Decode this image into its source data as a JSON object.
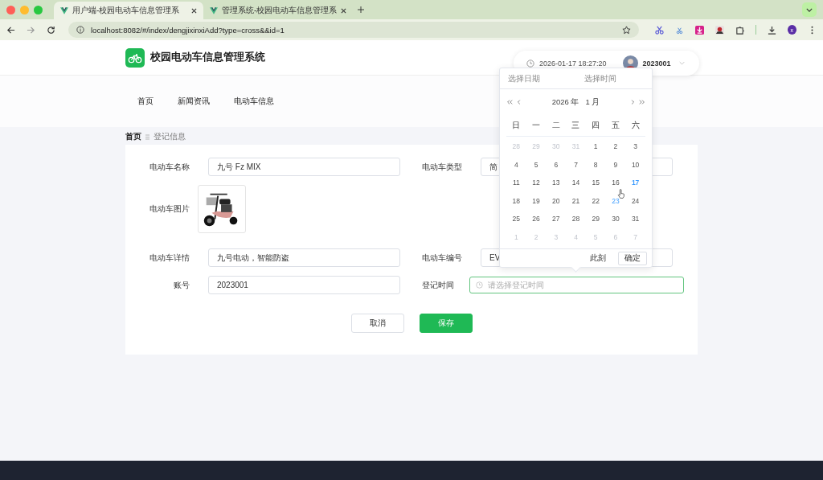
{
  "browser": {
    "tabs": [
      {
        "title": "用户端-校园电动车信息管理系",
        "selected": true
      },
      {
        "title": "管理系统-校园电动车信息管理系",
        "selected": false
      }
    ],
    "address": "localhost:8082/#/index/dengjixinxiAdd?type=cross&&id=1",
    "profile": "x"
  },
  "header": {
    "title": "校园电动车信息管理系统",
    "datetime": "2026-01-17 18:27:20",
    "user": "2023001"
  },
  "nav": [
    "首页",
    "新闻资讯",
    "电动车信息"
  ],
  "breadcrumb": [
    "首页",
    "登记信息"
  ],
  "form": {
    "rows": [
      [
        {
          "kind": "text",
          "label": "电动车名称",
          "value": "九号 Fz MIX"
        },
        {
          "kind": "text",
          "label": "电动车类型",
          "value": "简"
        }
      ],
      [
        {
          "label": "电动车图片"
        }
      ],
      [
        {
          "kind": "text",
          "label": "电动车详情",
          "value": "九号电动，智能防盗"
        },
        {
          "kind": "text",
          "label": "电动车编号",
          "value": "EV"
        }
      ],
      [
        {
          "kind": "text",
          "label": "账号",
          "value": "2023001"
        },
        {
          "kind": "datetime",
          "label": "登记时间",
          "placeholder": "请选择登记时间"
        }
      ]
    ],
    "buttons": [
      {
        "label": "取消",
        "kind": "default"
      },
      {
        "label": "保存",
        "kind": "primary"
      }
    ]
  },
  "calendar": {
    "tabs": [
      "选择日期",
      "选择时间"
    ],
    "year": "2026 年",
    "month": "1 月",
    "weekdays": [
      "日",
      "一",
      "二",
      "三",
      "四",
      "五",
      "六"
    ],
    "weeks": [
      [
        {
          "d": "28",
          "kind": "other"
        },
        {
          "d": "29",
          "kind": "other"
        },
        {
          "d": "30",
          "kind": "other"
        },
        {
          "d": "31",
          "kind": "other"
        },
        {
          "d": "1",
          "kind": "current"
        },
        {
          "d": "2",
          "kind": "current"
        },
        {
          "d": "3",
          "kind": "current"
        }
      ],
      [
        {
          "d": "4",
          "kind": "current"
        },
        {
          "d": "5",
          "kind": "current"
        },
        {
          "d": "6",
          "kind": "current"
        },
        {
          "d": "7",
          "kind": "current"
        },
        {
          "d": "8",
          "kind": "current"
        },
        {
          "d": "9",
          "kind": "current"
        },
        {
          "d": "10",
          "kind": "current"
        }
      ],
      [
        {
          "d": "11",
          "kind": "current"
        },
        {
          "d": "12",
          "kind": "current"
        },
        {
          "d": "13",
          "kind": "current"
        },
        {
          "d": "14",
          "kind": "current"
        },
        {
          "d": "15",
          "kind": "current"
        },
        {
          "d": "16",
          "kind": "current"
        },
        {
          "d": "17",
          "kind": "today"
        }
      ],
      [
        {
          "d": "18",
          "kind": "current"
        },
        {
          "d": "19",
          "kind": "current"
        },
        {
          "d": "20",
          "kind": "current"
        },
        {
          "d": "21",
          "kind": "current"
        },
        {
          "d": "22",
          "kind": "current"
        },
        {
          "d": "23",
          "kind": "hover"
        },
        {
          "d": "24",
          "kind": "current"
        }
      ],
      [
        {
          "d": "25",
          "kind": "current"
        },
        {
          "d": "26",
          "kind": "current"
        },
        {
          "d": "27",
          "kind": "current"
        },
        {
          "d": "28",
          "kind": "current"
        },
        {
          "d": "29",
          "kind": "current"
        },
        {
          "d": "30",
          "kind": "current"
        },
        {
          "d": "31",
          "kind": "current"
        }
      ],
      [
        {
          "d": "1",
          "kind": "other"
        },
        {
          "d": "2",
          "kind": "other"
        },
        {
          "d": "3",
          "kind": "other"
        },
        {
          "d": "4",
          "kind": "other"
        },
        {
          "d": "5",
          "kind": "other"
        },
        {
          "d": "6",
          "kind": "other"
        },
        {
          "d": "7",
          "kind": "other"
        }
      ]
    ],
    "footer": [
      {
        "label": "此刻",
        "kind": "link"
      },
      {
        "label": "确定",
        "kind": "default"
      }
    ]
  }
}
